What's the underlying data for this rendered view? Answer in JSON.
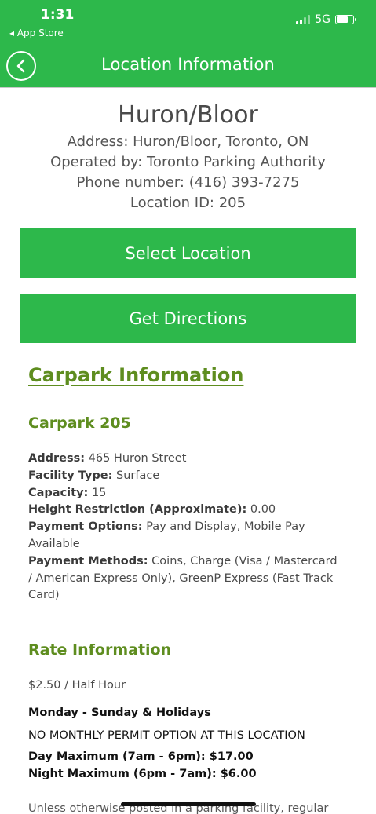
{
  "status": {
    "time": "1:31",
    "back_app": "◂ App Store",
    "network": "5G",
    "battery_level": 0.75
  },
  "nav": {
    "title": "Location Information",
    "back_icon": "chevron-left-circle-icon"
  },
  "location": {
    "name": "Huron/Bloor",
    "address": "Address: Huron/Bloor, Toronto, ON",
    "operator": "Operated by: Toronto Parking Authority",
    "phone": "Phone number: (416) 393-7275",
    "location_id": "Location ID: 205"
  },
  "buttons": {
    "select_location": "Select Location",
    "get_directions": "Get Directions"
  },
  "carpark_info": {
    "heading": "Carpark Information",
    "subheading": "Carpark 205",
    "fields": [
      {
        "label": "Address:",
        "value": "465 Huron Street"
      },
      {
        "label": "Facility Type:",
        "value": "Surface"
      },
      {
        "label": "Capacity:",
        "value": "15"
      },
      {
        "label": "Height Restriction (Approximate):",
        "value": "0.00"
      },
      {
        "label": "Payment Options:",
        "value": "Pay and Display, Mobile Pay Available"
      },
      {
        "label": "Payment Methods:",
        "value": "Coins, Charge (Visa / Mastercard / American Express Only), GreenP Express (Fast Track Card)"
      }
    ]
  },
  "rate_info": {
    "heading": "Rate Information",
    "price": "$2.50 / Half Hour",
    "days": "Monday - Sunday & Holidays",
    "no_monthly": "NO MONTHLY PERMIT OPTION AT THIS LOCATION",
    "day_max": "Day Maximum (7am - 6pm): $17.00",
    "night_max": "Night Maximum (6pm - 7am): $6.00",
    "note_partial": "Unless otherwise posted in a parking facility, regular"
  },
  "colors": {
    "brand_green": "#2db84b",
    "heading_green": "#5e8d1f"
  }
}
